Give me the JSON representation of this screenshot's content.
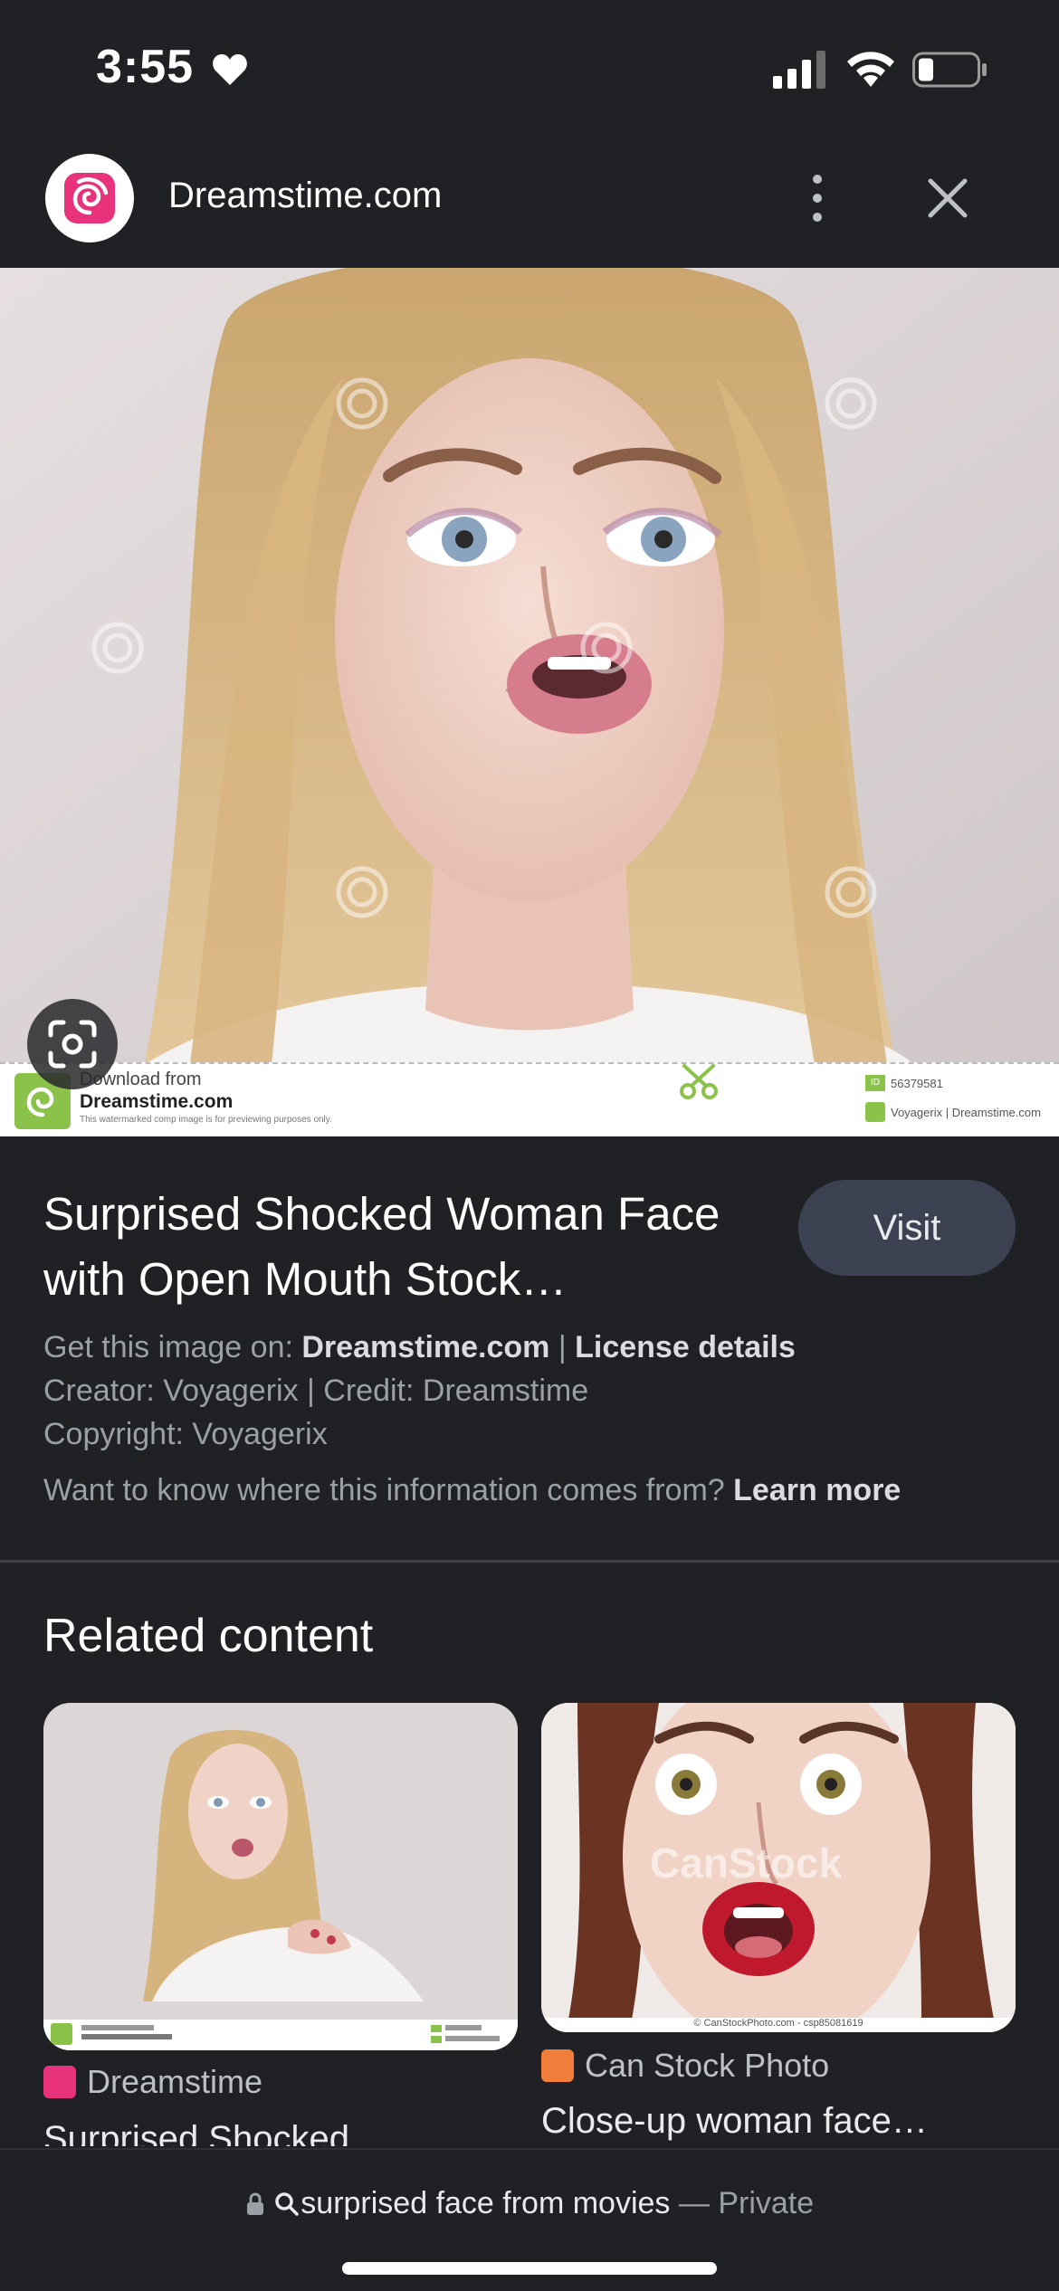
{
  "status_bar": {
    "time": "3:55"
  },
  "header": {
    "site_name": "Dreamstime.com"
  },
  "hero": {
    "banner_line1": "Download from",
    "banner_line2": "Dreamstime.com",
    "banner_line3": "This watermarked comp image is for previewing purposes only.",
    "banner_id_tag": "ID",
    "banner_id": "56379581",
    "banner_credit": "Voyagerix | Dreamstime.com"
  },
  "info": {
    "title": "Surprised Shocked Woman Face with Open Mouth Stock…",
    "visit_label": "Visit",
    "get_image_prefix": "Get this image on: ",
    "get_image_source": "Dreamstime.com",
    "separator": " | ",
    "license_label": "License details",
    "creator_credit": "Creator: Voyagerix | Credit: Dreamstime",
    "copyright": "Copyright: Voyagerix",
    "learn_prefix": "Want to know where this information comes from? ",
    "learn_more": "Learn more"
  },
  "related": {
    "heading": "Related content",
    "cards": [
      {
        "source": "Dreamstime",
        "title": "Surprised Shocked",
        "favicon_color": "#e8327c"
      },
      {
        "source": "Can Stock Photo",
        "title": "Close-up woman face…",
        "watermark": "CanStock",
        "footer": "© CanStockPhoto.com - csp85081619",
        "favicon_color": "#f07d3a"
      }
    ]
  },
  "bottom_bar": {
    "query": "surprised face from movies",
    "dash": " — ",
    "private": "Private"
  },
  "colors": {
    "background": "#202124",
    "visit_button": "#3c4252",
    "dreamstime_brand": "#e8327c",
    "dreamstime_green": "#8bc34a"
  }
}
